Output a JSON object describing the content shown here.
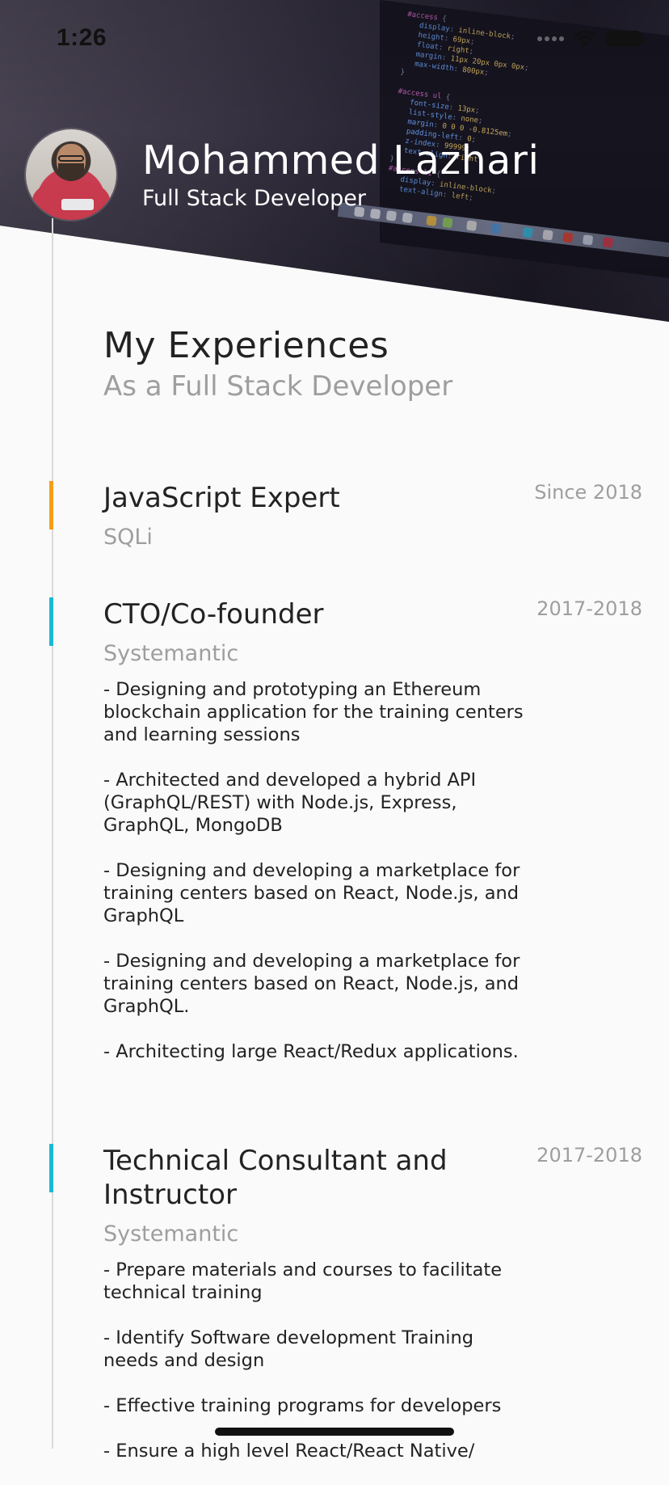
{
  "status_bar": {
    "time": "1:26",
    "icons": [
      "signal-icon",
      "wifi-icon",
      "battery-icon"
    ]
  },
  "profile": {
    "name": "Mohammed Lazhari",
    "title": "Full Stack Developer"
  },
  "section": {
    "title": "My Experiences",
    "subtitle": "As a Full Stack Developer"
  },
  "experiences": [
    {
      "role": "JavaScript Expert",
      "company": "SQLi",
      "period": "Since 2018",
      "marker_color": "#f59e16",
      "bullets": []
    },
    {
      "role": "CTO/Co-founder",
      "company": "Systemantic",
      "period": "2017-2018",
      "marker_color": "#1bb8d6",
      "bullets": [
        "- Designing and prototyping an Ethereum blockchain application for the training centers and learning sessions",
        "- Architected and developed a hybrid API (GraphQL/REST) with Node.js, Express, GraphQL, MongoDB",
        "- Designing and developing a marketplace for training centers based on React, Node.js, and GraphQL",
        "- Designing and developing a marketplace for training centers based on React, Node.js, and GraphQL.",
        "- Architecting large React/Redux applications."
      ]
    },
    {
      "role": "Technical Consultant and Instructor",
      "company": "Systemantic",
      "period": "2017-2018",
      "marker_color": "#1bb8d6",
      "bullets": [
        "- Prepare materials and courses to facilitate technical training",
        "- Identify Software development Training needs and design",
        "- Effective training programs for developers",
        "- Ensure a high level React/React Native/"
      ]
    }
  ]
}
